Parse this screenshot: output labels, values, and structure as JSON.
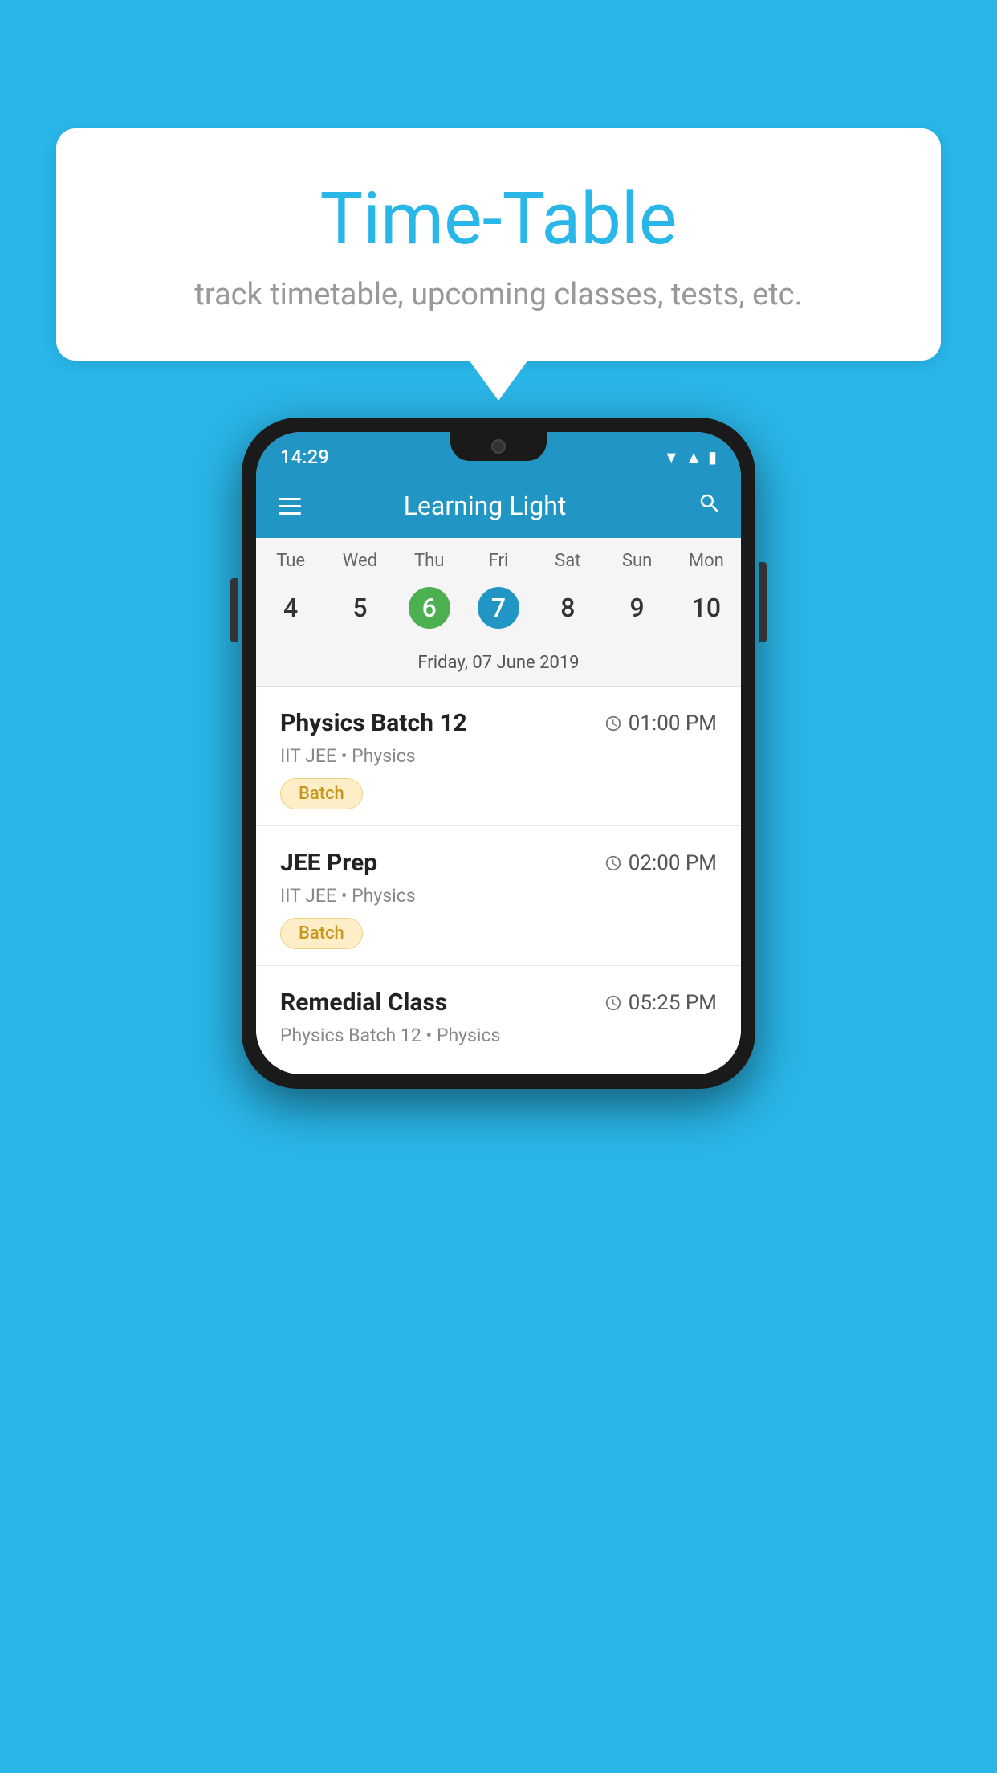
{
  "background_color": "#29b6e8",
  "speech_bubble": {
    "title": "Time-Table",
    "subtitle": "track timetable, upcoming classes, tests, etc."
  },
  "phone": {
    "status_bar": {
      "time": "14:29"
    },
    "app_bar": {
      "title": "Learning Light"
    },
    "calendar": {
      "day_headers": [
        "Tue",
        "Wed",
        "Thu",
        "Fri",
        "Sat",
        "Sun",
        "Mon"
      ],
      "day_numbers": [
        {
          "number": "4",
          "state": "normal"
        },
        {
          "number": "5",
          "state": "normal"
        },
        {
          "number": "6",
          "state": "today"
        },
        {
          "number": "7",
          "state": "selected"
        },
        {
          "number": "8",
          "state": "normal"
        },
        {
          "number": "9",
          "state": "normal"
        },
        {
          "number": "10",
          "state": "normal"
        }
      ],
      "selected_date_label": "Friday, 07 June 2019"
    },
    "schedule": {
      "items": [
        {
          "title": "Physics Batch 12",
          "time": "01:00 PM",
          "subtitle": "IIT JEE • Physics",
          "badge": "Batch"
        },
        {
          "title": "JEE Prep",
          "time": "02:00 PM",
          "subtitle": "IIT JEE • Physics",
          "badge": "Batch"
        },
        {
          "title": "Remedial Class",
          "time": "05:25 PM",
          "subtitle": "Physics Batch 12 • Physics",
          "badge": null
        }
      ]
    }
  },
  "icons": {
    "hamburger": "≡",
    "search": "🔍",
    "clock": "🕐"
  }
}
